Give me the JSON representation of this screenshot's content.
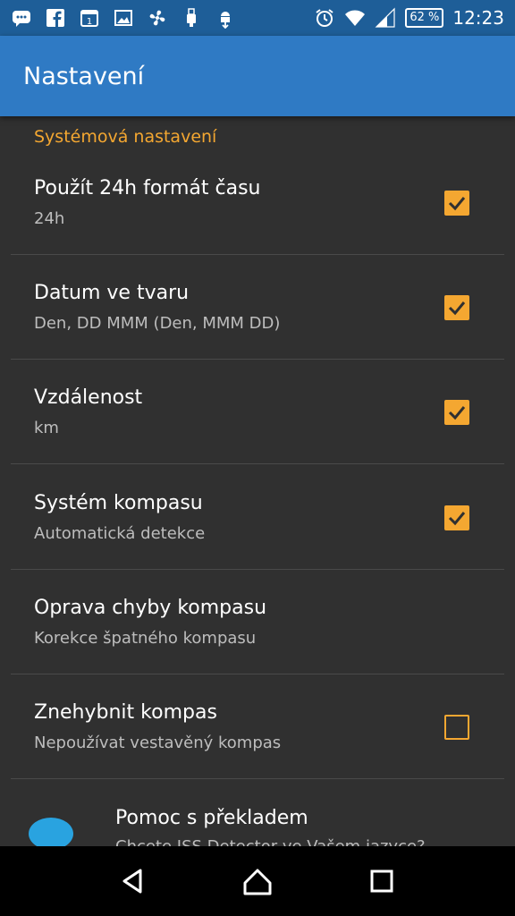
{
  "status_bar": {
    "left_icons": [
      "chat-icon",
      "facebook-icon",
      "calendar-icon",
      "image-icon",
      "fan-icon",
      "usb-icon",
      "android-download-icon"
    ],
    "right_icons": [
      "alarm-icon",
      "wifi-icon",
      "signal-icon"
    ],
    "battery": "62 %",
    "time": "12:23"
  },
  "app_bar": {
    "title": "Nastavení"
  },
  "section": {
    "header": "Systémová nastavení"
  },
  "preferences": [
    {
      "title": "Použít 24h formát času",
      "summary": "24h",
      "checked": true
    },
    {
      "title": "Datum ve tvaru",
      "summary": "Den, DD MMM (Den, MMM DD)",
      "checked": true
    },
    {
      "title": "Vzdálenost",
      "summary": "km",
      "checked": true
    },
    {
      "title": "Systém kompasu",
      "summary": "Automatická detekce",
      "checked": true
    },
    {
      "title": "Oprava chyby kompasu",
      "summary": "Korekce špatného kompasu",
      "checked": null
    },
    {
      "title": "Znehybnit kompas",
      "summary": "Nepoužívat vestavěný kompas",
      "checked": false
    }
  ],
  "help": {
    "title": "Pomoc s překladem",
    "summary": "Chcete ISS Detector ve Vašem jazyce?",
    "icon": "speech-bubble-icon"
  },
  "nav_bar": {
    "buttons": [
      "back-icon",
      "home-icon",
      "recents-icon"
    ]
  },
  "colors": {
    "accent": "#f4a731",
    "app_bar": "#2f7ac4",
    "status_bar": "#1e5e98",
    "background": "#303030"
  }
}
